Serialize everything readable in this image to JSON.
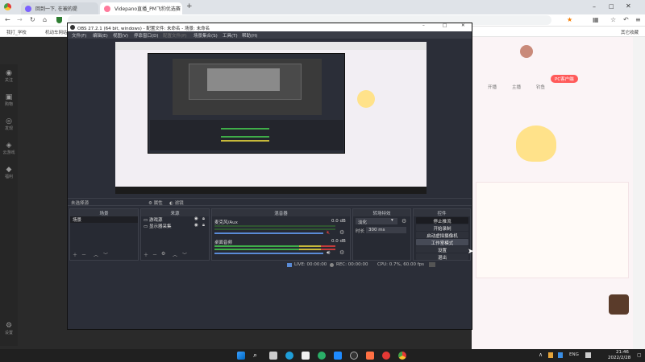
{
  "browser": {
    "tabs": [
      {
        "label": "回到一下, 在被的提"
      },
      {
        "label": "Videpano直播_PM飞豹优选赛"
      }
    ],
    "new_tab": "+",
    "address": "",
    "bookmarks": [
      "我打_学校",
      "机动车网站"
    ],
    "bookmark_right": "其它收藏"
  },
  "left_rail": [
    {
      "icon": "home-icon",
      "label": "关注"
    },
    {
      "icon": "follow-icon",
      "label": "购物"
    },
    {
      "icon": "explore-icon",
      "label": "发现"
    },
    {
      "icon": "game-icon",
      "label": "云游戏"
    },
    {
      "icon": "gift-icon",
      "label": "福利"
    },
    {
      "icon": "settings-icon",
      "label": "设置"
    }
  ],
  "obs": {
    "title": "OBS 27.2.1 (64 bit, windows) - 配置文件: 未命名 - 场景: 未命名",
    "menu": [
      "文件(F)",
      "编辑(E)",
      "视图(V)",
      "停靠窗口(D)",
      "配置文件(P)",
      "场景集合(S)",
      "工具(T)",
      "帮助(H)"
    ],
    "no_source_selected": "未选择源",
    "properties_label": "属性",
    "filters_label": "滤镜",
    "scenes": {
      "title": "场景",
      "items": [
        "场景"
      ]
    },
    "sources": {
      "title": "来源",
      "items": [
        "游戏源",
        "显示器采集"
      ]
    },
    "mixer": {
      "title": "混音器",
      "channels": [
        {
          "name": "麦克风/Aux",
          "db": "0.0 dB"
        },
        {
          "name": "桌面音频",
          "db": "0.0 dB"
        }
      ]
    },
    "transitions": {
      "title": "转场特效",
      "type": "淡化",
      "duration_label": "时长",
      "duration": "300 ms"
    },
    "controls": {
      "title": "控件",
      "buttons": [
        "停止推流",
        "开始录制",
        "启动虚拟摄像机",
        "工作室模式",
        "设置",
        "退出"
      ]
    },
    "status": {
      "live": "LIVE: 00:00:00",
      "rec": "REC: 00:00:00",
      "cpu": "CPU: 0.7%, 60.00 fps"
    }
  },
  "right_panel": {
    "stats": [
      "开播",
      "主播",
      "钓鱼"
    ],
    "badge": "PC客户端"
  },
  "taskbar": {
    "lang": "ENG",
    "time": "21:46",
    "date": "2022/2/28"
  },
  "colors": {
    "obs_bg": "#2b2e38",
    "dock_bg": "#272a33",
    "meter_green": "#3fae49",
    "meter_yellow": "#c7b93a",
    "meter_red": "#c53b3b",
    "chrome_tab_bar": "#dfe3e8"
  }
}
